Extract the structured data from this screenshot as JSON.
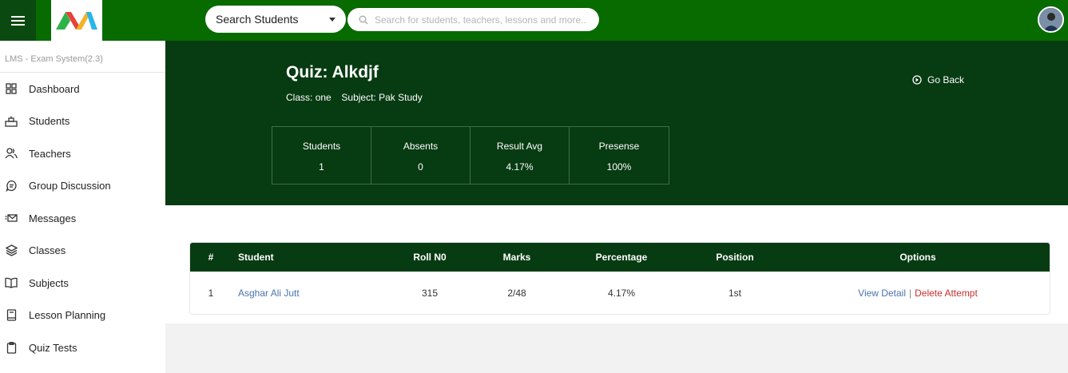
{
  "topbar": {
    "search_select_value": "Search Students",
    "search_placeholder": "Search for students, teachers, lessons and more..",
    "brand_color": "#076b00"
  },
  "sidebar": {
    "system_label": "LMS - Exam System(2.3)",
    "items": [
      {
        "label": "Dashboard",
        "icon": "dashboard-icon"
      },
      {
        "label": "Students",
        "icon": "students-icon"
      },
      {
        "label": "Teachers",
        "icon": "teachers-icon"
      },
      {
        "label": "Group Discussion",
        "icon": "chat-icon"
      },
      {
        "label": "Messages",
        "icon": "messages-icon"
      },
      {
        "label": "Classes",
        "icon": "layers-icon"
      },
      {
        "label": "Subjects",
        "icon": "book-icon"
      },
      {
        "label": "Lesson Planning",
        "icon": "notebook-icon"
      },
      {
        "label": "Quiz Tests",
        "icon": "clipboard-icon"
      }
    ]
  },
  "header": {
    "title": "Quiz: Alkdjf",
    "class_label": "Class:",
    "class_value": "one",
    "subject_label": "Subject:",
    "subject_value": "Pak Study",
    "go_back": "Go Back",
    "stats": [
      {
        "label": "Students",
        "value": "1"
      },
      {
        "label": "Absents",
        "value": "0"
      },
      {
        "label": "Result Avg",
        "value": "4.17%"
      },
      {
        "label": "Presense",
        "value": "100%"
      }
    ],
    "panel_color": "#073b12"
  },
  "table": {
    "headers": [
      "#",
      "Student",
      "Roll N0",
      "Marks",
      "Percentage",
      "Position",
      "Options"
    ],
    "rows": [
      {
        "num": "1",
        "student": "Asghar Ali Jutt",
        "roll": "315",
        "marks": "2/48",
        "percentage": "4.17%",
        "position": "1st",
        "view": "View Detail",
        "separator": "|",
        "delete": "Delete Attempt"
      }
    ]
  }
}
